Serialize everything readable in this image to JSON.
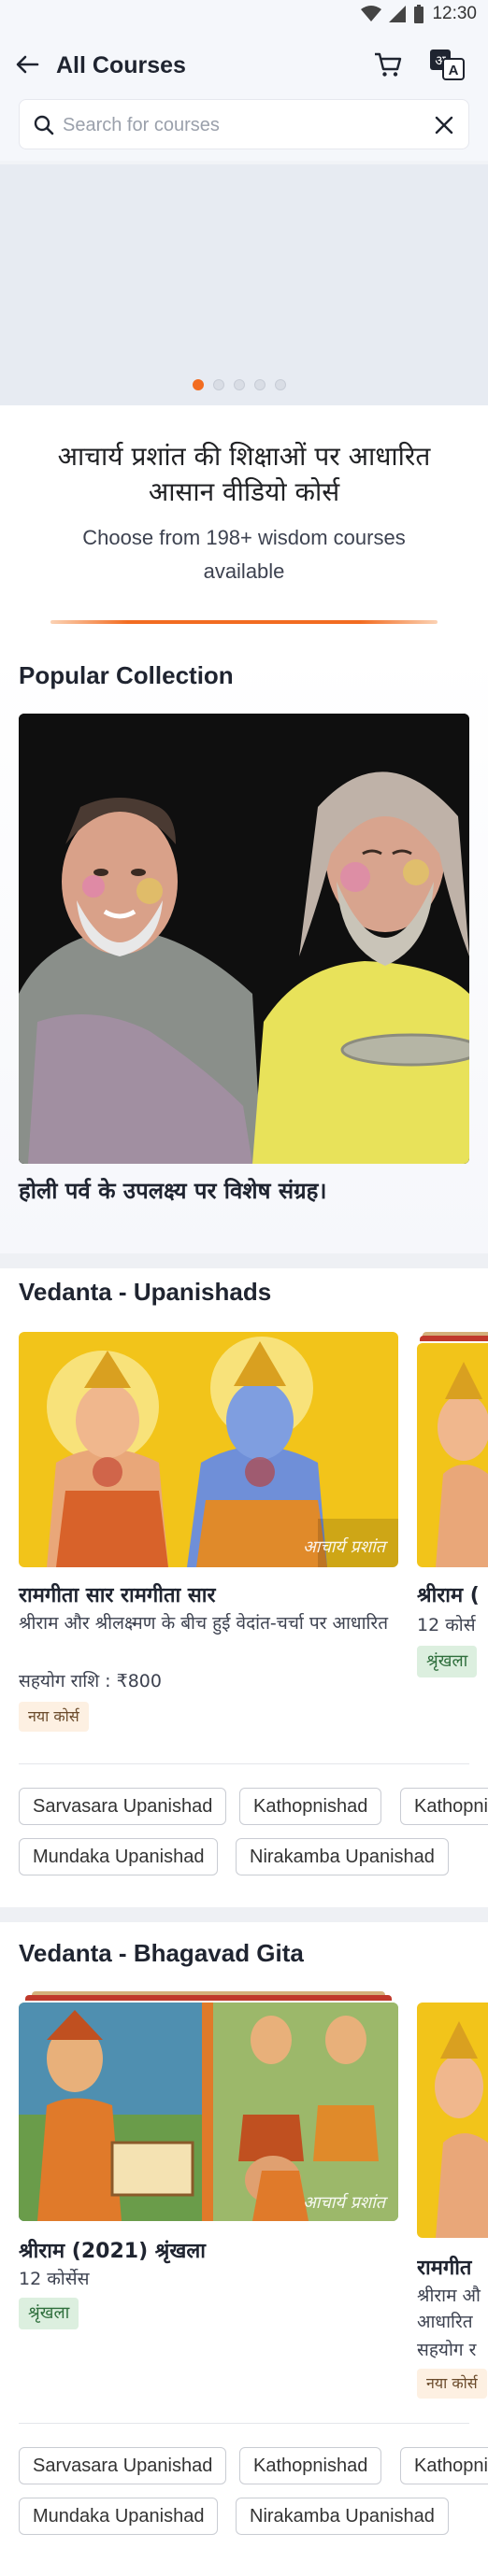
{
  "status_bar": {
    "time": "12:30"
  },
  "header": {
    "title": "All Courses"
  },
  "search": {
    "placeholder": "Search for courses",
    "value": ""
  },
  "carousel": {
    "page_count": 5,
    "active_index": 0
  },
  "intro": {
    "heading": "आचार्य प्रशांत की शिक्षाओं पर आधारित आसान वीडियो कोर्स",
    "subtitle": "Choose from 198+ wisdom courses available"
  },
  "popular": {
    "title": "Popular Collection",
    "caption": "होली पर्व के उपलक्ष्य पर विशेष संग्रह।"
  },
  "upanishads": {
    "title": "Vedanta - Upanishads",
    "card1": {
      "title": "रामगीता सार रामगीता सार",
      "desc": "श्रीराम और श्रीलक्ष्मण के बीच हुई वेदांत-चर्चा पर आधारित",
      "price": "सहयोग राशि : ₹800",
      "badge": "नया कोर्स",
      "watermark": "आचार्य प्रशांत"
    },
    "card2": {
      "title": "श्रीराम (",
      "count": "12 कोर्स",
      "badge": "श्रृंखला"
    },
    "chips": [
      "Sarvasara Upanishad",
      "Kathopnishad",
      "Kathopni",
      "Mundaka Upanishad",
      "Nirakamba Upanishad"
    ]
  },
  "gita": {
    "title": "Vedanta - Bhagavad Gita",
    "card1": {
      "title": "श्रीराम (2021) श्रृंखला",
      "count": "12 कोर्सेस",
      "badge": "श्रृंखला",
      "watermark": "आचार्य प्रशांत"
    },
    "card2": {
      "title": "रामगीत",
      "desc1": "श्रीराम औ",
      "desc2": "आधारित",
      "price": "सहयोग र",
      "badge": "नया कोर्स"
    },
    "chips": [
      "Sarvasara Upanishad",
      "Kathopnishad",
      "Kathopni",
      "Mundaka Upanishad",
      "Nirakamba Upanishad"
    ]
  },
  "colors": {
    "accent": "#f26c21",
    "badge_new_bg": "#fdf0e2",
    "badge_series_bg": "#dcefdf"
  }
}
